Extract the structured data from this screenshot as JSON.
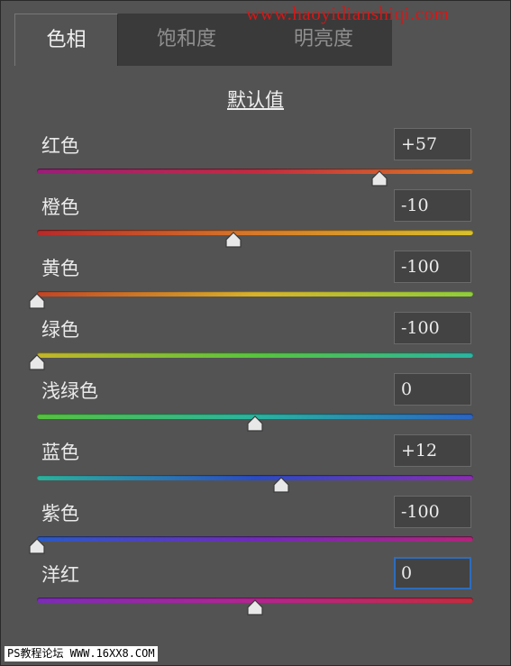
{
  "tabs": [
    {
      "label": "色相",
      "active": true
    },
    {
      "label": "饱和度",
      "active": false
    },
    {
      "label": "明亮度",
      "active": false
    }
  ],
  "watermark": "www.haoyidianshiqi.com",
  "default_label": "默认值",
  "sliders": [
    {
      "label": "红色",
      "value": "+57",
      "position": 0.785,
      "gradient": [
        "#9a1d7a",
        "#c42a40",
        "#d87a24"
      ]
    },
    {
      "label": "橙色",
      "value": "-10",
      "position": 0.45,
      "gradient": [
        "#b52a2a",
        "#d6792a",
        "#d8c12c"
      ]
    },
    {
      "label": "黄色",
      "value": "-100",
      "position": 0.0,
      "gradient": [
        "#c44424",
        "#d8b32a",
        "#8fce3a"
      ]
    },
    {
      "label": "绿色",
      "value": "-100",
      "position": 0.0,
      "gradient": [
        "#c4b52a",
        "#59c43e",
        "#2ab5a2"
      ]
    },
    {
      "label": "浅绿色",
      "value": "0",
      "position": 0.5,
      "gradient": [
        "#57c23f",
        "#2ab49f",
        "#2a64c4"
      ]
    },
    {
      "label": "蓝色",
      "value": "+12",
      "position": 0.56,
      "gradient": [
        "#2ab39b",
        "#2a4bc4",
        "#8a2bb4"
      ]
    },
    {
      "label": "紫色",
      "value": "-100",
      "position": 0.0,
      "gradient": [
        "#2a5ac4",
        "#6f2bb8",
        "#b3247a"
      ]
    },
    {
      "label": "洋红",
      "value": "0",
      "position": 0.5,
      "focused": true,
      "gradient": [
        "#7b2bb8",
        "#b3248f",
        "#c42a3c"
      ]
    }
  ],
  "footer": "PS教程论坛 WWW.16XX8.COM"
}
